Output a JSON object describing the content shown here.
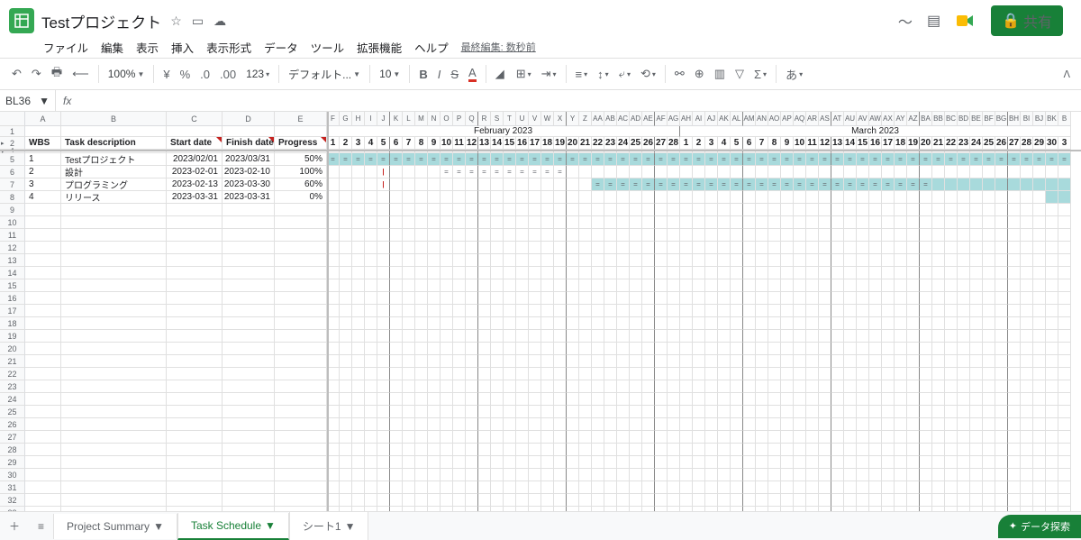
{
  "doc": {
    "title": "Testプロジェクト",
    "lastEdit": "最終編集: 数秒前"
  },
  "menus": {
    "file": "ファイル",
    "edit": "編集",
    "view": "表示",
    "insert": "挿入",
    "format": "表示形式",
    "data": "データ",
    "tools": "ツール",
    "ext": "拡張機能",
    "help": "ヘルプ"
  },
  "share": "共有",
  "toolbar": {
    "zoom": "100%",
    "yen": "¥",
    "pct": "%",
    "dec1": ".0",
    "dec2": ".00",
    "fmt": "123",
    "font": "デフォ­ルト...",
    "size": "10",
    "input": "あ"
  },
  "nameBox": "BL36",
  "cols": [
    "A",
    "B",
    "C",
    "D",
    "E"
  ],
  "ganttCols": [
    "F",
    "G",
    "H",
    "I",
    "J",
    "K",
    "L",
    "M",
    "N",
    "O",
    "P",
    "Q",
    "R",
    "S",
    "T",
    "U",
    "V",
    "W",
    "X",
    "Y",
    "Z",
    "AA",
    "AB",
    "AC",
    "AD",
    "AE",
    "AF",
    "AG",
    "AH",
    "AI",
    "AJ",
    "AK",
    "AL",
    "AM",
    "AN",
    "AO",
    "AP",
    "AQ",
    "AR",
    "AS",
    "AT",
    "AU",
    "AV",
    "AW",
    "AX",
    "AY",
    "AZ",
    "BA",
    "BB",
    "BC",
    "BD",
    "BE",
    "BF",
    "BG",
    "BH",
    "BI",
    "BJ",
    "BK",
    "B"
  ],
  "month1": "February 2023",
  "month2": "March 2023",
  "days": [
    "1",
    "2",
    "3",
    "4",
    "5",
    "6",
    "7",
    "8",
    "9",
    "10",
    "11",
    "12",
    "13",
    "14",
    "15",
    "16",
    "17",
    "18",
    "19",
    "20",
    "21",
    "22",
    "23",
    "24",
    "25",
    "26",
    "27",
    "28",
    "1",
    "2",
    "3",
    "4",
    "5",
    "6",
    "7",
    "8",
    "9",
    "10",
    "11",
    "12",
    "13",
    "14",
    "15",
    "16",
    "17",
    "18",
    "19",
    "20",
    "21",
    "22",
    "23",
    "24",
    "25",
    "26",
    "27",
    "28",
    "29",
    "30",
    "3"
  ],
  "headers": {
    "wbs": "WBS",
    "task": "Task description",
    "start": "Start date",
    "finish": "Finish date",
    "progress": "Progress"
  },
  "tasks": [
    {
      "wbs": "1",
      "desc": "Testプロジェクト",
      "start": "2023/02/01",
      "finish": "2023/03/31",
      "prog": "50%",
      "barFrom": 0,
      "barTo": 58,
      "markFrom": 0,
      "markTo": 58
    },
    {
      "wbs": "2",
      "desc": "設計",
      "start": "2023-02-01",
      "finish": "2023-02-10",
      "prog": "100%",
      "barFrom": 0,
      "barTo": -1,
      "markFrom": 9,
      "markTo": 18
    },
    {
      "wbs": "3",
      "desc": "プログラミング",
      "start": "2023-02-13",
      "finish": "2023-03-30",
      "prog": "60%",
      "barFrom": 21,
      "barTo": 58,
      "markFrom": 21,
      "markTo": 47
    },
    {
      "wbs": "4",
      "desc": "リリース",
      "start": "2023-03-31",
      "finish": "2023-03-31",
      "prog": "0%",
      "barFrom": 57,
      "barTo": 58,
      "markFrom": -1,
      "markTo": -1
    }
  ],
  "weekBreaks": [
    4,
    11,
    18,
    25,
    32,
    39,
    46,
    53
  ],
  "tabs": {
    "t1": "Project Summary",
    "t2": "Task Schedule",
    "t3": "シート1"
  },
  "explore": "データ探索"
}
